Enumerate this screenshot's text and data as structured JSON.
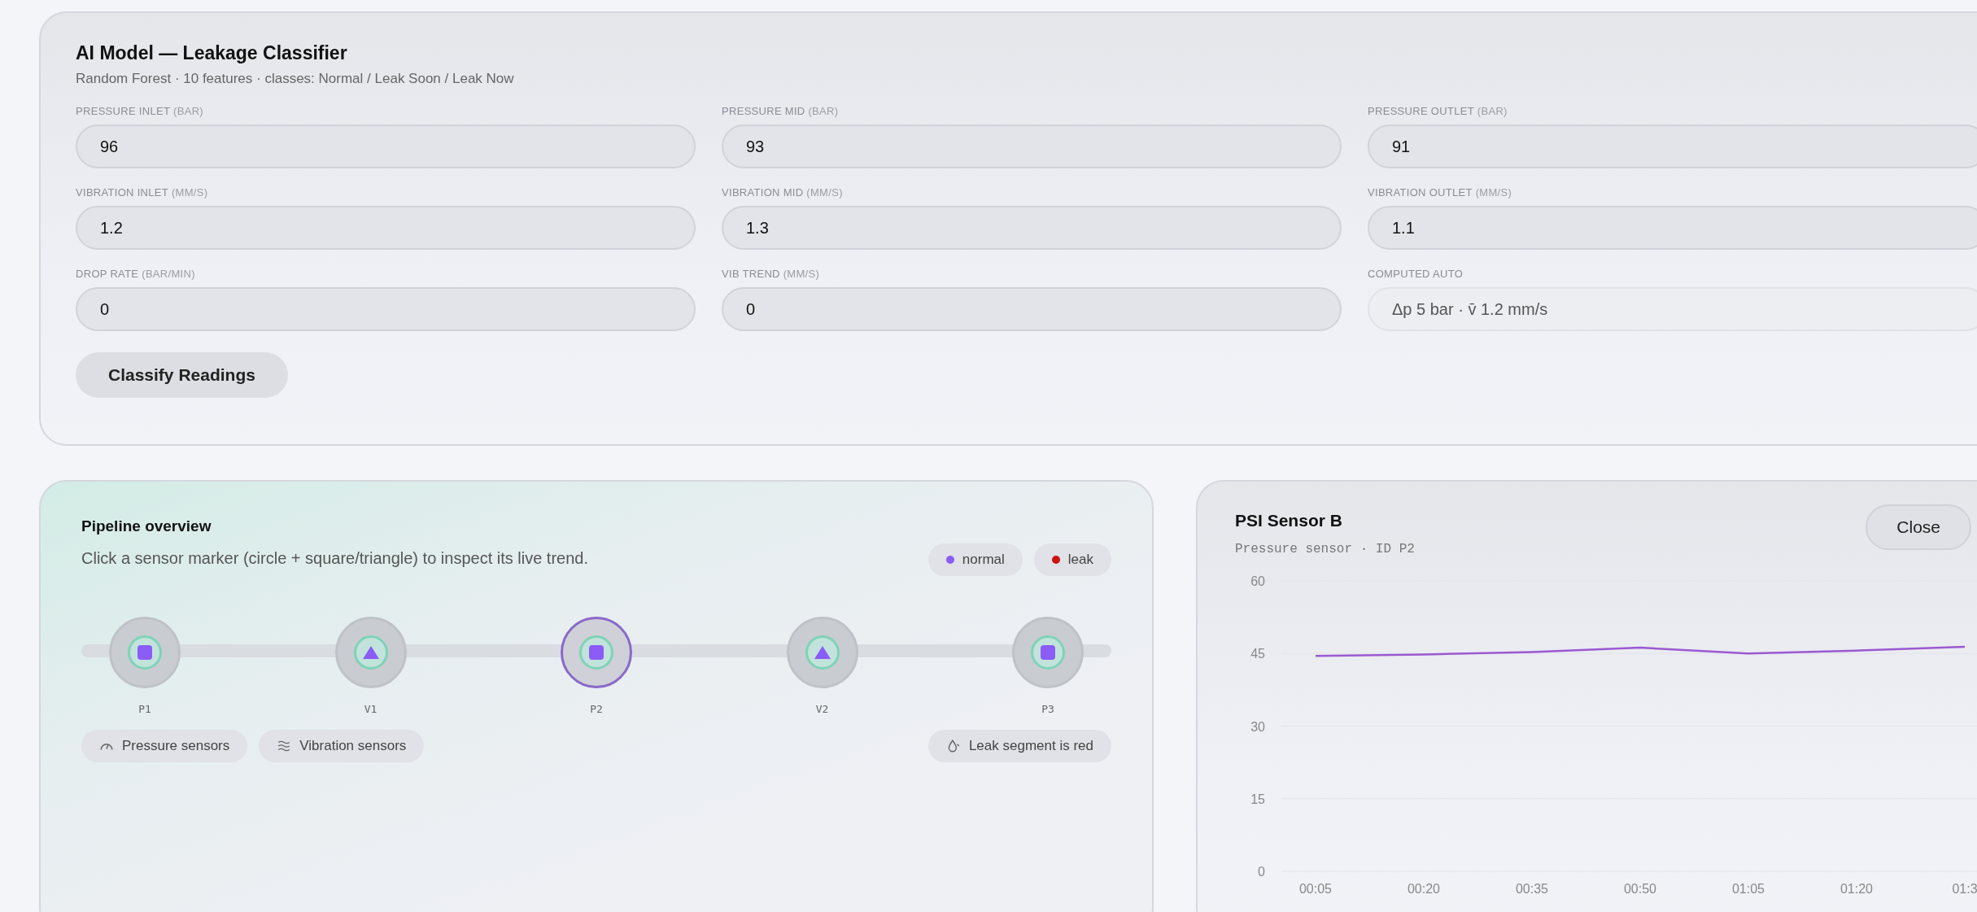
{
  "model": {
    "title": "AI Model — Leakage Classifier",
    "subtitle": "Random Forest · 10 features · classes: Normal / Leak Soon / Leak Now",
    "fields": [
      {
        "label": "PRESSURE INLET",
        "unit": "(BAR)",
        "value": "96",
        "kind": "input"
      },
      {
        "label": "PRESSURE MID",
        "unit": "(BAR)",
        "value": "93",
        "kind": "input"
      },
      {
        "label": "PRESSURE OUTLET",
        "unit": "(BAR)",
        "value": "91",
        "kind": "input"
      },
      {
        "label": "VIBRATION INLET",
        "unit": "(MM/S)",
        "value": "1.2",
        "kind": "input"
      },
      {
        "label": "VIBRATION MID",
        "unit": "(MM/S)",
        "value": "1.3",
        "kind": "input"
      },
      {
        "label": "VIBRATION OUTLET",
        "unit": "(MM/S)",
        "value": "1.1",
        "kind": "input"
      },
      {
        "label": "DROP RATE",
        "unit": "(BAR/MIN)",
        "value": "0",
        "kind": "input"
      },
      {
        "label": "VIB TREND",
        "unit": "(MM/S)",
        "value": "0",
        "kind": "input"
      },
      {
        "label": "COMPUTED AUTO",
        "value": "Δp 5 bar  ·  v̄ 1.2 mm/s",
        "kind": "computed"
      }
    ],
    "button": "Classify Readings"
  },
  "pipeline": {
    "title": "Pipeline overview",
    "description": "Click a sensor marker (circle + square/triangle) to inspect its live trend.",
    "legend": [
      {
        "label": "normal",
        "color": "#8b5cf6"
      },
      {
        "label": "leak",
        "color": "#cc1111"
      }
    ],
    "sensors": [
      {
        "label": "P1",
        "kind": "pressure",
        "selected": false,
        "leak": false
      },
      {
        "label": "V1",
        "kind": "vibration",
        "selected": false,
        "leak": false
      },
      {
        "label": "P2",
        "kind": "pressure",
        "selected": true,
        "leak": false
      },
      {
        "label": "V2",
        "kind": "vibration",
        "selected": false,
        "leak": false
      },
      {
        "label": "P3",
        "kind": "pressure",
        "selected": false,
        "leak": false
      }
    ],
    "notes": [
      {
        "label": "Pressure sensors",
        "kind": "gauge"
      },
      {
        "label": "Vibration sensors",
        "kind": "waves"
      },
      {
        "label": "Leak segment is red",
        "kind": "drop"
      }
    ]
  },
  "detail": {
    "title": "PSI Sensor B",
    "subtitle": "Pressure sensor · ID P2",
    "close": "Close",
    "chart_data": {
      "type": "line",
      "categories": [
        "00:05",
        "00:20",
        "00:35",
        "00:50",
        "01:05",
        "01:20",
        "01:3"
      ],
      "series": [
        {
          "color": "#9b59d0",
          "values": [
            44.5,
            44.8,
            45.3,
            46.2,
            45.0,
            45.6,
            46.4
          ]
        }
      ],
      "ylim": [
        0,
        60
      ],
      "yticks": [
        0,
        15,
        30,
        45,
        60
      ],
      "grid": true
    }
  }
}
